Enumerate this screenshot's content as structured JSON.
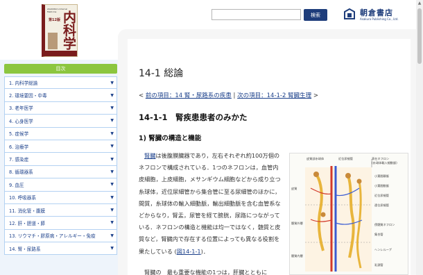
{
  "header": {
    "cover": {
      "top_text": "ASAKURA's Internal Medicine",
      "edition": "第12版",
      "title": "内科学"
    },
    "search": {
      "placeholder": "",
      "button_label": "検索"
    },
    "publisher": {
      "name": "朝倉書店",
      "sub": "Asakura Publishing Co., Ltd."
    }
  },
  "sidebar": {
    "toc_title": "目次",
    "items": [
      {
        "label": "1.  内科学総論"
      },
      {
        "label": "2.  環境要因・中毒"
      },
      {
        "label": "3.  老年医学"
      },
      {
        "label": "4.  心身医学"
      },
      {
        "label": "5.  症候学"
      },
      {
        "label": "6.  治療学"
      },
      {
        "label": "7.  感染症"
      },
      {
        "label": "8.  循環器系"
      },
      {
        "label": "9.  血圧"
      },
      {
        "label": "10.  呼吸器系"
      },
      {
        "label": "11.  消化管・腹膜"
      },
      {
        "label": "12.  肝・胆道・膵"
      },
      {
        "label": "13.  リウマチ・膠原病・アレルギー・免疫"
      },
      {
        "label": "14.  腎・尿路系"
      }
    ],
    "arrow_glyph": "▼"
  },
  "content": {
    "chapter_title": "14-1 総論",
    "nav": {
      "open": "< ",
      "prev_link": "前の項目：14 腎・尿路系の疾患",
      "separator": " | ",
      "next_link": "次の項目：14-1-2 腎臓生理",
      "close": " >"
    },
    "section_title": "14-1-1　腎疾患患者のみかた",
    "subsection_title": "1) 腎臓の構造と機能",
    "paragraph": {
      "keyword": "腎臓",
      "text": "は後腹膜臓器であり，左右それぞれ約100万個のネフロンで構成されている．1つのネフロンは，血管内皮細胞，上皮細胞，メサンギウム細胞などから成り立つ糸球体，近位尿細管から集合管に至る尿細管のほかに，間質，糸球体の輸入細動脈，輸出細動脈を含む血管系などからなり，腎盂，尿管を経て膀胱，尿路につながっている．ネフロンの構造と機能は均一ではなく，髄質と皮質など，腎臓内で存在する位置によっても異なる役割を果たしている (",
      "fig_link": "図14-1-1",
      "tail": ")．"
    },
    "paragraph2": "腎臓の　最も重要な機能の1つは，肝臓とともに"
  },
  "figure": {
    "labels": {
      "top_left": "皮質部糸球体",
      "top_mid": "近位尿細管",
      "top_right1": "表在ネフロン",
      "top_right2": "(糸球体輸入細動脈)",
      "right1": "小葉間静脈",
      "right2": "小葉間動脈",
      "right3": "近位尿細管",
      "right4": "遠位尿細管",
      "left1": "皮質",
      "left2": "髄質外層",
      "left3": "髄質内層",
      "right5": "傍髄質ネフロン",
      "right6": "集合管",
      "right7": "ヘンレループ",
      "right8": "乳頭管"
    },
    "colors": {
      "artery": "#d23a2a",
      "vein": "#3a5bd2",
      "tubule": "#e8b53c",
      "capsule": "#c98a3a"
    }
  },
  "colors": {
    "accent_navy": "#1e3d7b",
    "link": "#1a3f8a",
    "toc_header": "#8cc63f",
    "sidebar_bg": "#eef4fb"
  }
}
